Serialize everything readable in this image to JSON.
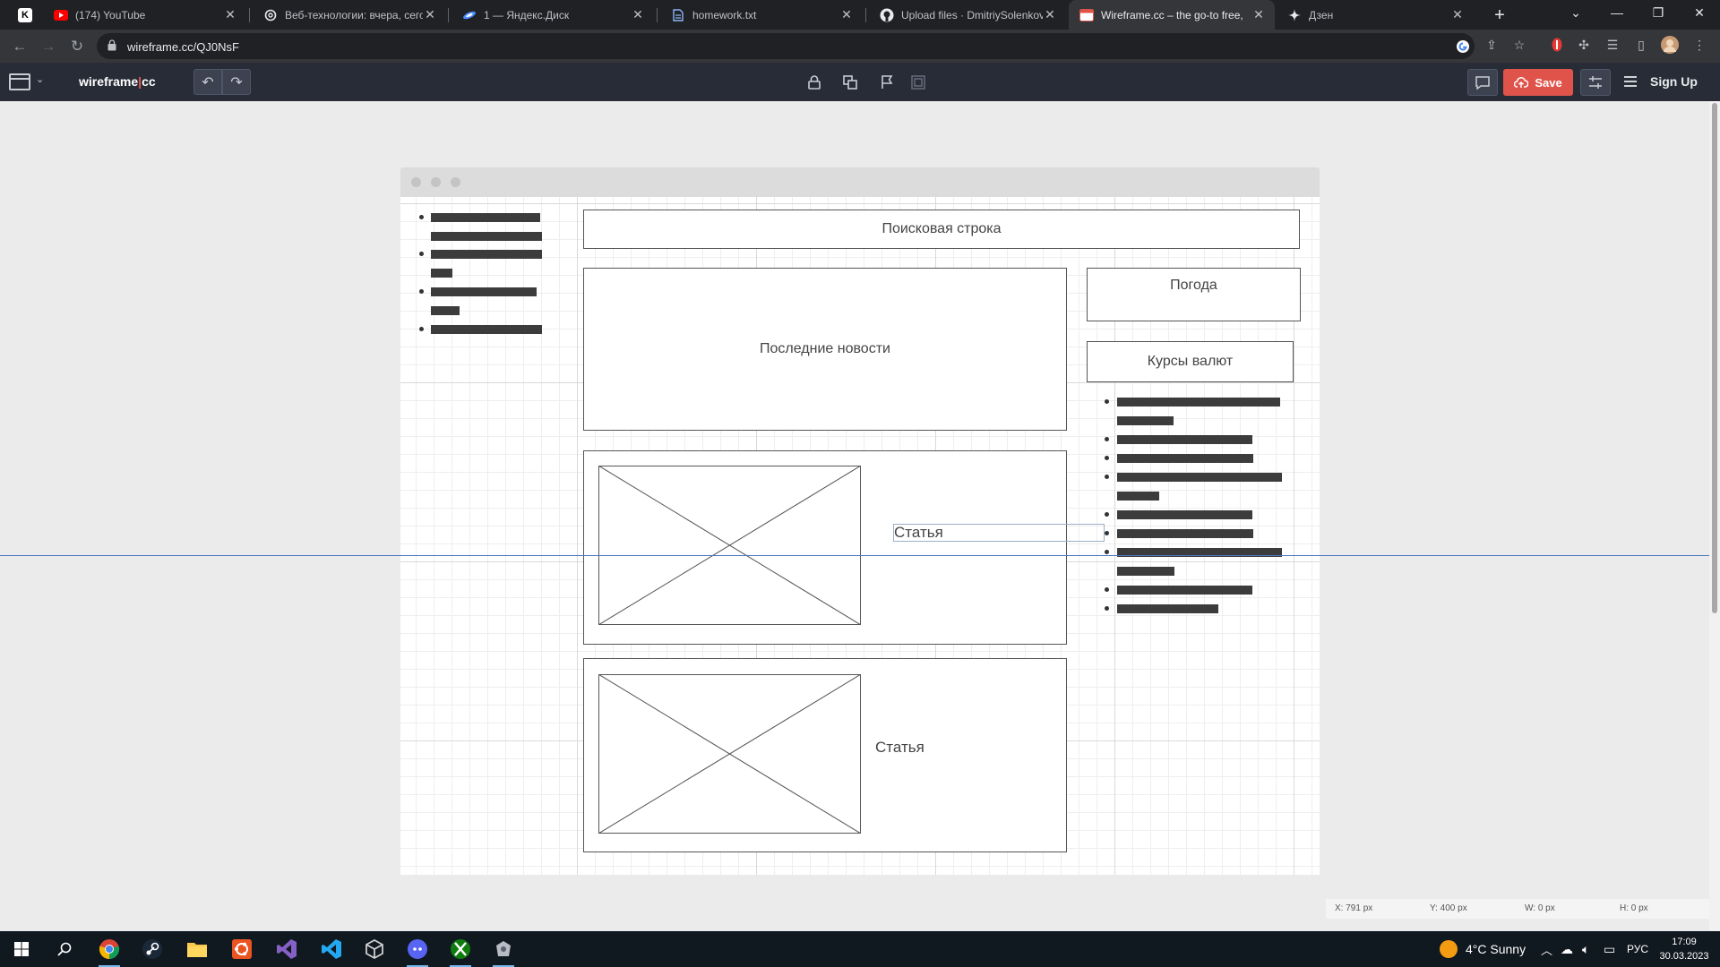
{
  "browser": {
    "tabs": [
      {
        "title": "",
        "icon": "kinopoisk-icon",
        "active": false
      },
      {
        "title": "(174) YouTube",
        "icon": "youtube-icon",
        "active": false
      },
      {
        "title": "Веб-технологии: вчера, сегод",
        "icon": "openai-icon",
        "active": false
      },
      {
        "title": "1 — Яндекс.Диск",
        "icon": "yandex-disk-icon",
        "active": false
      },
      {
        "title": "homework.txt",
        "icon": "document-icon",
        "active": false
      },
      {
        "title": "Upload files · DmitriySolenkov/",
        "icon": "github-icon",
        "active": false
      },
      {
        "title": "Wireframe.cc – the go-to free, ",
        "icon": "wireframe-icon",
        "active": true
      },
      {
        "title": "Дзен",
        "icon": "dzen-icon",
        "active": false
      }
    ],
    "url": "wireframe.cc/QJ0NsF"
  },
  "app": {
    "logo_main": "wireframe",
    "logo_pipe": "|",
    "logo_suffix": "cc",
    "save_label": "Save",
    "signup_label": "Sign Up"
  },
  "wireframe": {
    "search_label": "Поисковая строка",
    "news_label": "Последние новости",
    "weather_label": "Погода",
    "currency_label": "Курсы валют",
    "article1_label": "Статья",
    "article2_label": "Статья"
  },
  "status": {
    "x": "X: 791 px",
    "y": "Y: 400 px",
    "w": "W: 0 px",
    "h": "H: 0 px"
  },
  "taskbar": {
    "apps": [
      "start-icon",
      "search-icon",
      "chrome-icon",
      "steam-icon",
      "file-explorer-icon",
      "ubuntu-icon",
      "visual-studio-icon",
      "vscode-icon",
      "virtualbox-icon",
      "discord-icon",
      "xbox-icon",
      "game-icon"
    ],
    "weather": "4°C  Sunny",
    "language": "РУС",
    "time": "17:09",
    "date": "30.03.2023"
  },
  "colors": {
    "save_button": "#e0534a",
    "app_toolbar": "#282c37",
    "guide_line": "#4a78c0"
  }
}
